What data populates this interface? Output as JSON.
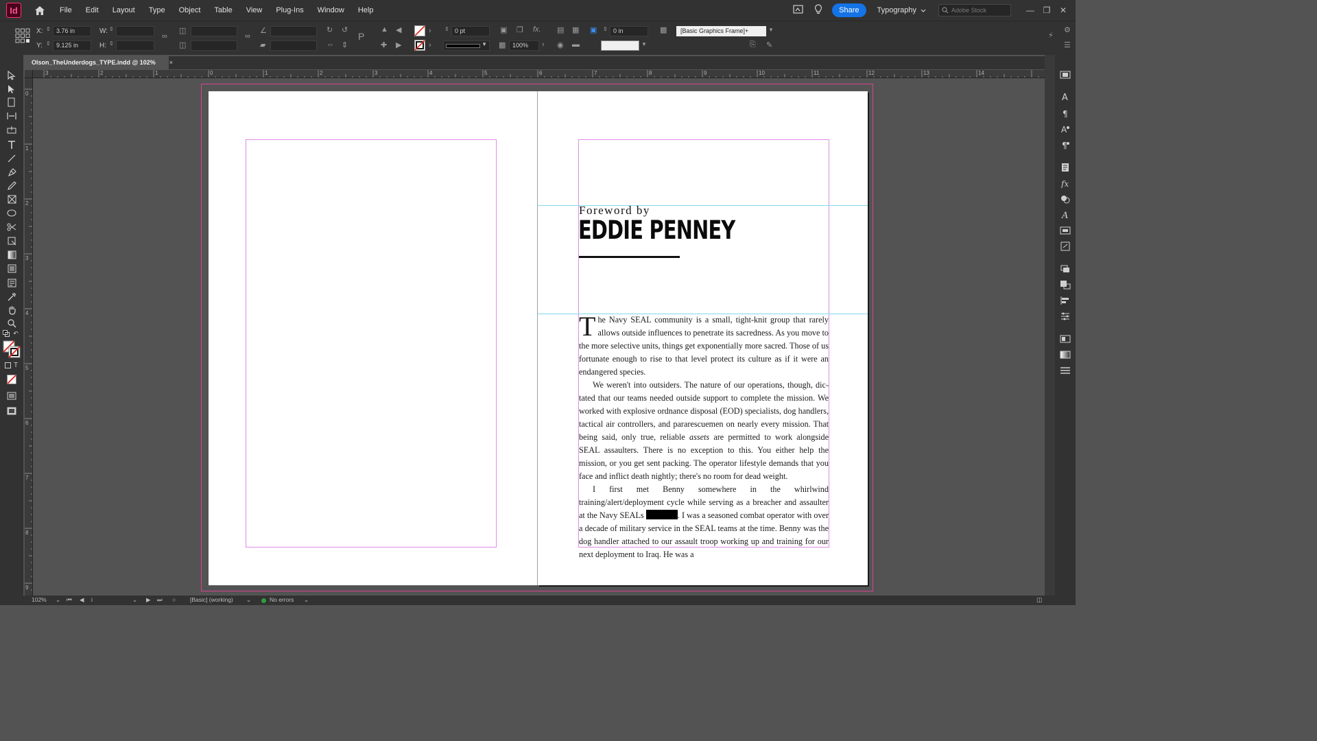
{
  "app": {
    "logo": "Id",
    "menus": [
      "File",
      "Edit",
      "Layout",
      "Type",
      "Object",
      "Table",
      "View",
      "Plug-Ins",
      "Window",
      "Help"
    ],
    "share_label": "Share",
    "workspace": "Typography",
    "stock_placeholder": "Adobe Stock"
  },
  "control_panel": {
    "x_label": "X:",
    "x_value": "3.76 in",
    "y_label": "Y:",
    "y_value": "9.125 in",
    "w_label": "W:",
    "h_label": "H:",
    "stroke_weight": "0 pt",
    "opacity": "100%",
    "offset": "0 in",
    "frame_style": "[Basic Graphics Frame]+"
  },
  "document": {
    "tab_title": "Olson_TheUnderdogs_TYPE.indd @ 102%",
    "close_glyph": "×"
  },
  "ruler": {
    "top_numbers": [
      "3",
      "2",
      "1",
      "0",
      "1",
      "2",
      "3",
      "4",
      "5",
      "6",
      "7",
      "8",
      "9",
      "10",
      "11",
      "12",
      "13",
      "14"
    ],
    "left_numbers": [
      "0",
      "1",
      "2",
      "3",
      "4",
      "5",
      "6",
      "7",
      "8",
      "9"
    ]
  },
  "page": {
    "kicker": "Foreword by",
    "name": "EDDIE PENNEY",
    "dropcap": "T",
    "para1": "he Navy SEAL community is a small, tight-knit group that rarely allows outside influences to penetrate its sacredness. As you move to the more selective units, things get exponentially more sacred. Those of us fortu­nate enough to rise to that level protect its culture as if it were an endangered species.",
    "para2_a": "We weren't into outsiders. The nature of our operations, though, dic­tated that our teams needed outside support to complete the mission. We worked with explosive ordnance disposal (EOD) specialists, dog handlers, tactical air controllers, and pararescuemen on nearly every mission. That being said, only true, reliable ",
    "para2_em": "assets",
    "para2_b": " are permitted to work alongside SEAL assaulters. There is no exception to this. You either help the mission, or you get sent packing. The operator lifestyle demands that you face and inflict death nightly; there's no room for dead weight.",
    "para3_a": "I first met Benny somewhere in the whirlwind training/alert/deployment cycle while serving as a breacher and assaulter at the Navy SEALs ",
    "para3_b": ". I was a seasoned combat operator with over a decade of military service in the SEAL teams at the time. Benny was the dog handler attached to our assault troop working up and training for our next deployment to Iraq. He was a"
  },
  "status": {
    "zoom": "102%",
    "page_num": "i",
    "preflight_profile": "[Basic] (working)",
    "errors": "No errors"
  }
}
